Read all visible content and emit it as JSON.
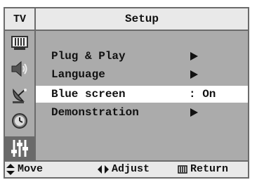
{
  "header": {
    "tv_label": "TV",
    "title": "Setup"
  },
  "sidebar": {
    "icons": [
      {
        "name": "picture-icon"
      },
      {
        "name": "sound-icon"
      },
      {
        "name": "channel-icon"
      },
      {
        "name": "time-icon"
      },
      {
        "name": "setup-icon",
        "active": true
      }
    ]
  },
  "menu": {
    "items": [
      {
        "label": "Plug & Play",
        "value": "",
        "has_arrow": true
      },
      {
        "label": "Language",
        "value": "",
        "has_arrow": true
      },
      {
        "label": "Blue screen",
        "value": ": On",
        "has_arrow": false,
        "selected": true
      },
      {
        "label": "Demonstration",
        "value": "",
        "has_arrow": true
      }
    ]
  },
  "footer": {
    "move_label": "Move",
    "adjust_label": "Adjust",
    "return_label": "Return"
  },
  "colors": {
    "panel": "#ababab",
    "header": "#e9e9e9",
    "border": "#6b6b6b",
    "highlight": "#ffffff",
    "active_icon_bg": "#6a6a6a"
  }
}
